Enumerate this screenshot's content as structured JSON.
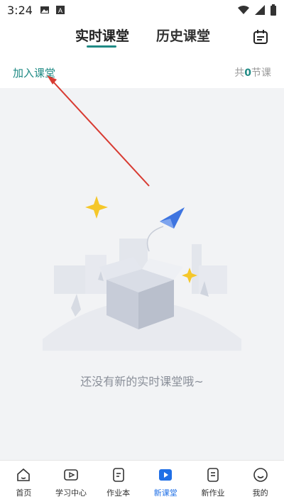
{
  "status_bar": {
    "time": "3:24",
    "icons": [
      "image-icon",
      "a-icon",
      "wifi-icon",
      "signal-icon",
      "battery-icon"
    ]
  },
  "header": {
    "tabs": [
      {
        "label": "实时课堂",
        "active": true
      },
      {
        "label": "历史课堂",
        "active": false
      }
    ],
    "icon": "calendar-icon",
    "accent": "#1f8a84"
  },
  "subheader": {
    "join_label": "加入课堂",
    "count_prefix": "共",
    "count_value": "0",
    "count_suffix": "节课"
  },
  "empty_state": {
    "message": "还没有新的实时课堂哦~"
  },
  "bottom_nav": {
    "items": [
      {
        "label": "首页",
        "icon": "home-icon",
        "active": false
      },
      {
        "label": "学习中心",
        "icon": "play-icon",
        "active": false
      },
      {
        "label": "作业本",
        "icon": "notebook-icon",
        "active": false
      },
      {
        "label": "新课堂",
        "icon": "video-icon",
        "active": true
      },
      {
        "label": "新作业",
        "icon": "homework-icon",
        "active": false
      },
      {
        "label": "我的",
        "icon": "profile-icon",
        "active": false
      }
    ],
    "active_color": "#1f6fe6"
  }
}
